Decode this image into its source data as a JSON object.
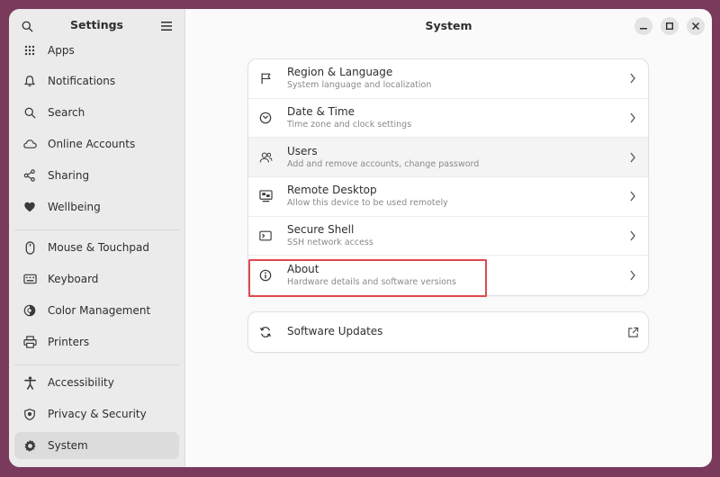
{
  "sidebar": {
    "title": "Settings",
    "items": [
      {
        "label": "Apps",
        "icon": "apps-icon"
      },
      {
        "label": "Notifications",
        "icon": "bell-icon"
      },
      {
        "label": "Search",
        "icon": "search-icon"
      },
      {
        "label": "Online Accounts",
        "icon": "cloud-icon"
      },
      {
        "label": "Sharing",
        "icon": "share-icon"
      },
      {
        "label": "Wellbeing",
        "icon": "wellbeing-icon"
      },
      {
        "label": "Mouse & Touchpad",
        "icon": "mouse-icon"
      },
      {
        "label": "Keyboard",
        "icon": "keyboard-icon"
      },
      {
        "label": "Color Management",
        "icon": "color-icon"
      },
      {
        "label": "Printers",
        "icon": "printer-icon"
      },
      {
        "label": "Accessibility",
        "icon": "accessibility-icon"
      },
      {
        "label": "Privacy & Security",
        "icon": "privacy-icon"
      },
      {
        "label": "System",
        "icon": "gear-icon"
      }
    ]
  },
  "main": {
    "title": "System",
    "rows": [
      {
        "title": "Region & Language",
        "subtitle": "System language and localization",
        "icon": "flag-icon"
      },
      {
        "title": "Date & Time",
        "subtitle": "Time zone and clock settings",
        "icon": "clock-icon"
      },
      {
        "title": "Users",
        "subtitle": "Add and remove accounts, change password",
        "icon": "users-icon"
      },
      {
        "title": "Remote Desktop",
        "subtitle": "Allow this device to be used remotely",
        "icon": "remote-desktop-icon"
      },
      {
        "title": "Secure Shell",
        "subtitle": "SSH network access",
        "icon": "terminal-icon"
      },
      {
        "title": "About",
        "subtitle": "Hardware details and software versions",
        "icon": "info-icon"
      }
    ],
    "updates": {
      "title": "Software Updates",
      "icon": "refresh-icon"
    }
  },
  "colors": {
    "accent_highlight": "#e0484f",
    "desktop": "#7a3a5c"
  }
}
